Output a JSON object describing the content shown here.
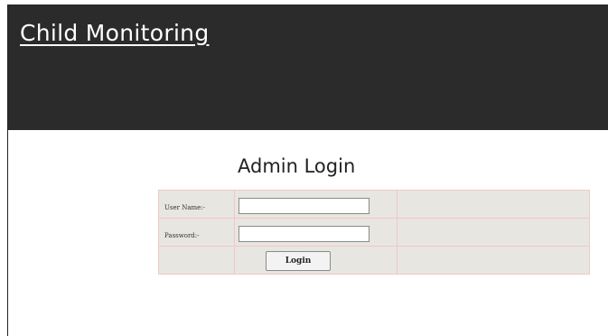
{
  "header": {
    "site_title": "Child Monitoring"
  },
  "login": {
    "heading": "Admin Login",
    "username_label": "User Name:-",
    "username_value": "",
    "password_label": "Password:-",
    "password_value": "",
    "submit_label": "Login"
  }
}
